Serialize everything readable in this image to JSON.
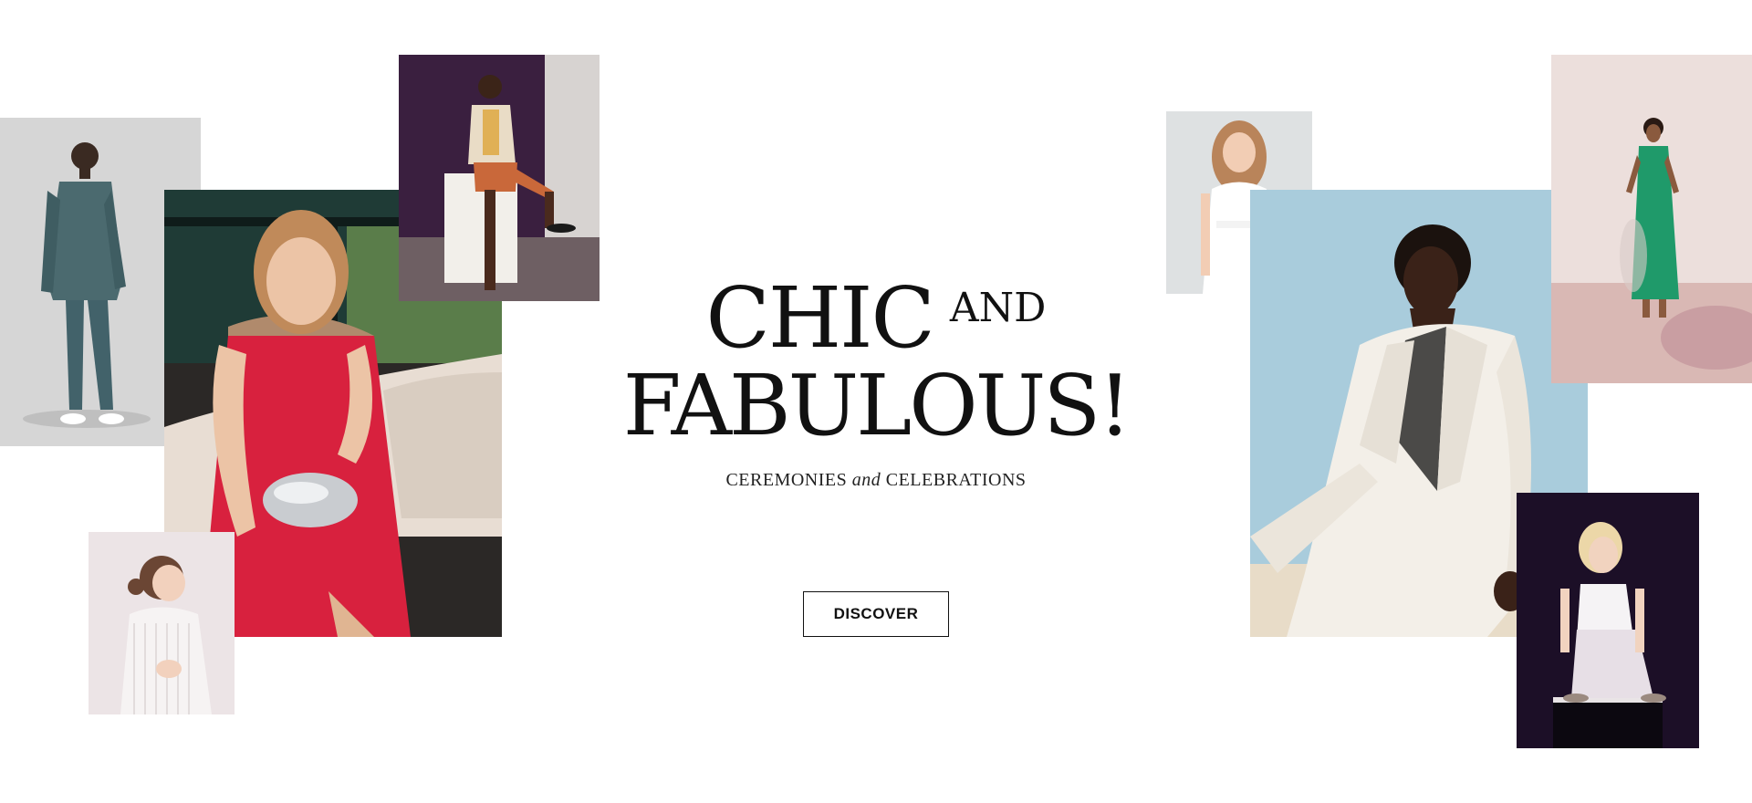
{
  "hero": {
    "title_line1": "CHIC",
    "title_and": "AND",
    "title_line2": "FABULOUS!",
    "subtitle_part1": "CEREMONIES",
    "subtitle_and": "and",
    "subtitle_part2": "CELEBRATIONS",
    "cta_label": "DISCOVER"
  },
  "photos": [
    {
      "name": "man-in-teal-suit-photo",
      "background": "#d6d6d6",
      "accent": "#4b6a6f"
    },
    {
      "name": "woman-in-red-dress-photo",
      "background": "#1f3b36",
      "accent": "#d8213e"
    },
    {
      "name": "boy-on-white-block-photo",
      "background": "#3a1f3f",
      "accent": "#c9683a"
    },
    {
      "name": "toddler-in-white-dress-photo",
      "background": "#ece4e6",
      "accent": "#f6f3f3"
    },
    {
      "name": "girl-in-white-dress-photo",
      "background": "#dee1e2",
      "accent": "#ffffff"
    },
    {
      "name": "man-in-white-suit-photo",
      "background": "#a9ccdc",
      "accent": "#f3efe8"
    },
    {
      "name": "woman-in-green-dress-photo",
      "background": "#ecdfdc",
      "accent": "#1f9a6a"
    },
    {
      "name": "blonde-child-sitting-photo",
      "background": "#1c0f27",
      "accent": "#e7dfe6"
    }
  ]
}
